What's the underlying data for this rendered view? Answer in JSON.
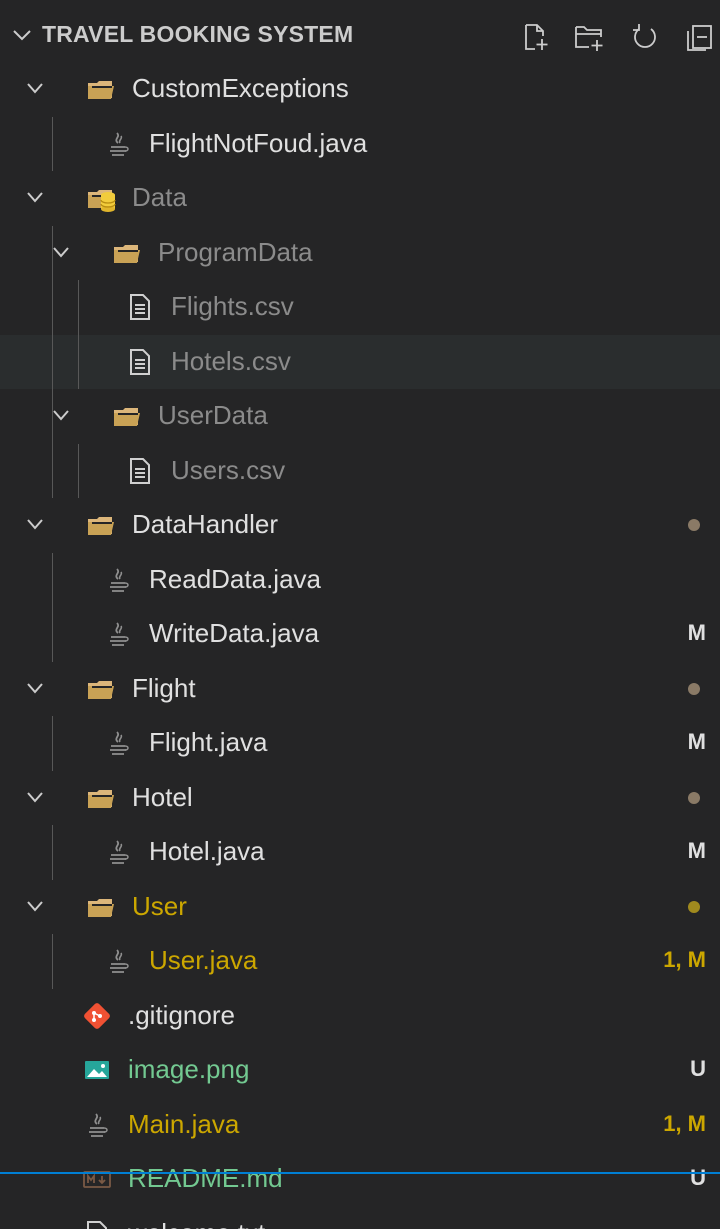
{
  "explorer": {
    "section_title": "TRAVEL BOOKING SYSTEM",
    "actions": [
      "new-file-icon",
      "new-folder-icon",
      "refresh-icon",
      "collapse-all-icon"
    ]
  },
  "colors": {
    "background": "#252526",
    "hover_row": "#2a2d2e",
    "folder": "#dcb67a",
    "modified_text": "#e2c08d",
    "warning_text": "#cca700",
    "untracked_text": "#73c991",
    "ignored_text": "#8b8b8b",
    "focus_line": "#007fd4",
    "java_icon": "#8f8f8f",
    "git_icon": "#f05133",
    "image_icon": "#26a69a"
  },
  "tree": [
    {
      "name": "CustomExceptions",
      "type": "folder",
      "depth": 0,
      "expanded": true,
      "badge": "",
      "dot": false
    },
    {
      "name": "FlightNotFoud.java",
      "type": "java",
      "depth": 1,
      "badge": "",
      "dot": false
    },
    {
      "name": "Data",
      "type": "folder-db",
      "depth": 0,
      "expanded": true,
      "badge": "",
      "dot": false
    },
    {
      "name": "ProgramData",
      "type": "folder",
      "depth": 1,
      "expanded": true,
      "badge": "",
      "dot": false
    },
    {
      "name": "Flights.csv",
      "type": "text",
      "depth": 2,
      "badge": "",
      "dot": false
    },
    {
      "name": "Hotels.csv",
      "type": "text",
      "depth": 2,
      "badge": "",
      "dot": false
    },
    {
      "name": "UserData",
      "type": "folder",
      "depth": 1,
      "expanded": true,
      "badge": "",
      "dot": false
    },
    {
      "name": "Users.csv",
      "type": "text",
      "depth": 2,
      "badge": "",
      "dot": false
    },
    {
      "name": "DataHandler",
      "type": "folder",
      "depth": 0,
      "expanded": true,
      "badge": "",
      "dot": true
    },
    {
      "name": "ReadData.java",
      "type": "java",
      "depth": 1,
      "badge": "",
      "dot": false
    },
    {
      "name": "WriteData.java",
      "type": "java",
      "depth": 1,
      "badge": "M",
      "dot": false
    },
    {
      "name": "Flight",
      "type": "folder",
      "depth": 0,
      "expanded": true,
      "badge": "",
      "dot": true
    },
    {
      "name": "Flight.java",
      "type": "java",
      "depth": 1,
      "badge": "M",
      "dot": false
    },
    {
      "name": "Hotel",
      "type": "folder",
      "depth": 0,
      "expanded": true,
      "badge": "",
      "dot": true
    },
    {
      "name": "Hotel.java",
      "type": "java",
      "depth": 1,
      "badge": "M",
      "dot": false
    },
    {
      "name": "User",
      "type": "folder",
      "depth": 0,
      "expanded": true,
      "badge": "",
      "dot": true
    },
    {
      "name": "User.java",
      "type": "java",
      "depth": 1,
      "badge": "1, M",
      "dot": false
    },
    {
      "name": ".gitignore",
      "type": "git",
      "depth": 0,
      "badge": "",
      "dot": false
    },
    {
      "name": "image.png",
      "type": "image",
      "depth": 0,
      "badge": "U",
      "dot": false
    },
    {
      "name": "Main.java",
      "type": "java",
      "depth": 0,
      "badge": "1, M",
      "dot": false
    },
    {
      "name": "README.md",
      "type": "markdown",
      "depth": 0,
      "badge": "U",
      "dot": false
    },
    {
      "name": "welcome.txt",
      "type": "text",
      "depth": 0,
      "badge": "",
      "dot": false
    }
  ]
}
